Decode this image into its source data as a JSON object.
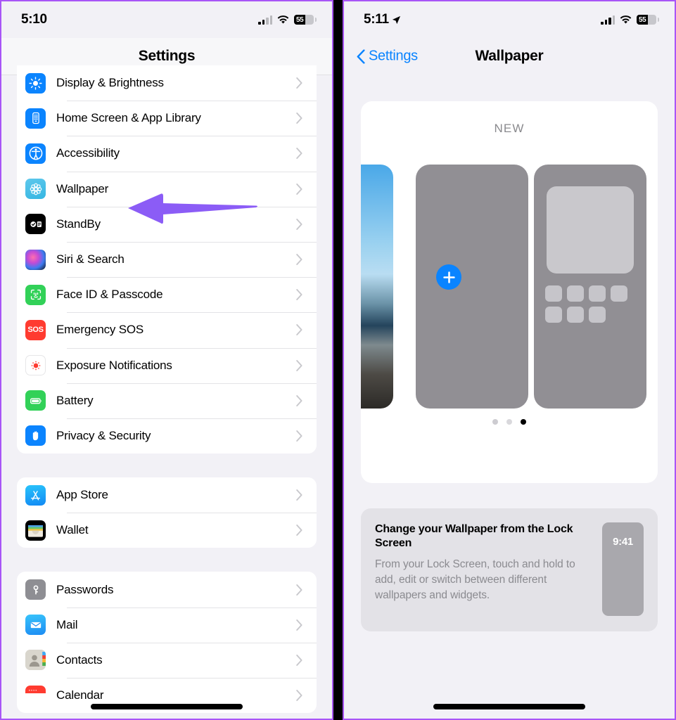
{
  "left_panel": {
    "status": {
      "time": "5:10",
      "battery_level": "55",
      "battery_pct": 55
    },
    "nav": {
      "title": "Settings"
    },
    "groups": [
      {
        "items": [
          {
            "label": "Display & Brightness",
            "icon": "brightness-icon"
          },
          {
            "label": "Home Screen & App Library",
            "icon": "home-screen-icon"
          },
          {
            "label": "Accessibility",
            "icon": "accessibility-icon"
          },
          {
            "label": "Wallpaper",
            "icon": "wallpaper-icon"
          },
          {
            "label": "StandBy",
            "icon": "standby-icon"
          },
          {
            "label": "Siri & Search",
            "icon": "siri-icon"
          },
          {
            "label": "Face ID & Passcode",
            "icon": "face-id-icon"
          },
          {
            "label": "Emergency SOS",
            "icon": "sos-icon"
          },
          {
            "label": "Exposure Notifications",
            "icon": "exposure-notifications-icon"
          },
          {
            "label": "Battery",
            "icon": "battery-icon"
          },
          {
            "label": "Privacy & Security",
            "icon": "privacy-hand-icon"
          }
        ]
      },
      {
        "items": [
          {
            "label": "App Store",
            "icon": "app-store-icon"
          },
          {
            "label": "Wallet",
            "icon": "wallet-icon"
          }
        ]
      },
      {
        "items": [
          {
            "label": "Passwords",
            "icon": "key-icon"
          },
          {
            "label": "Mail",
            "icon": "mail-icon"
          },
          {
            "label": "Contacts",
            "icon": "contacts-icon"
          },
          {
            "label": "Calendar",
            "icon": "calendar-icon"
          }
        ]
      }
    ]
  },
  "right_panel": {
    "status": {
      "time": "5:11",
      "battery_level": "55",
      "battery_pct": 55
    },
    "nav": {
      "back_label": "Settings",
      "title": "Wallpaper"
    },
    "gallery": {
      "section_label": "NEW",
      "add_button_label": "+",
      "page_dots": 3,
      "active_dot": 3
    },
    "info_card": {
      "title": "Change your Wallpaper from the Lock Screen",
      "body": "From your Lock Screen, touch and hold to add, edit or switch between different wallpapers and widgets.",
      "preview_time": "9:41"
    }
  },
  "annotations": {
    "accent_color": "#8b5cf6",
    "left_arrow_target": "Wallpaper",
    "right_arrow_target": "add-wallpaper-button"
  }
}
